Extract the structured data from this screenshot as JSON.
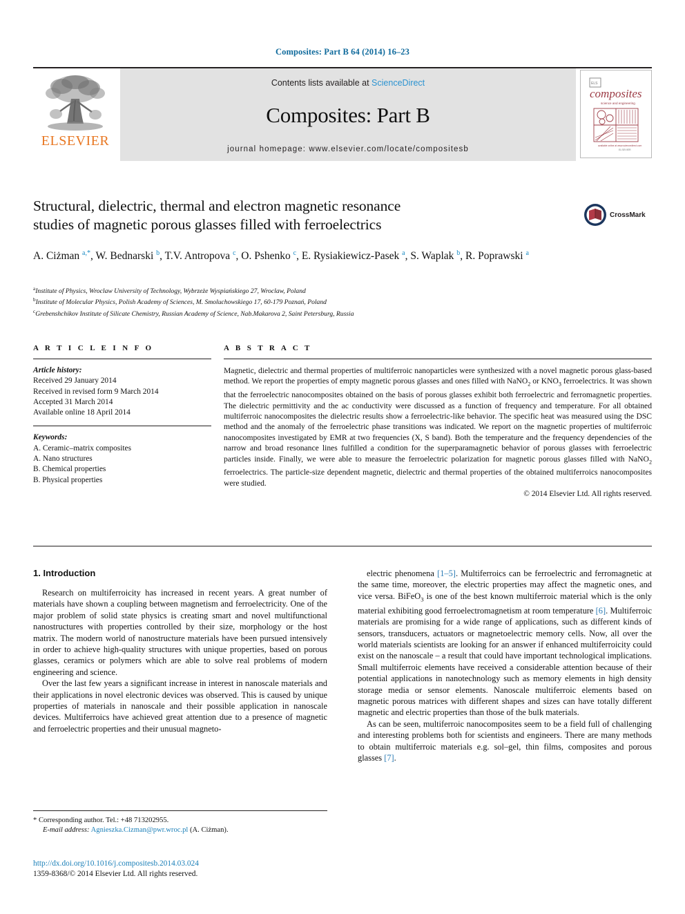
{
  "running_head": "Composites: Part B 64 (2014) 16–23",
  "journal_header": {
    "contents_prefix": "Contents lists available at",
    "sciencedirect_link": "ScienceDirect",
    "journal_title": "Composites: Part B",
    "homepage_line": "journal homepage: www.elsevier.com/locate/compositesb",
    "publisher_name": "ELSEVIER",
    "cover_title": "composites",
    "cover_subtitle": "science and engineering"
  },
  "article": {
    "title_line1": "Structural, dielectric, thermal and electron magnetic resonance",
    "title_line2": "studies of magnetic porous glasses filled with ferroelectrics",
    "crossmark_label": "CrossMark",
    "authors_html": "A. Ciżman <sup>a,*</sup>, W. Bednarski <sup>b</sup>, T.V. Antropova <sup>c</sup>, O. Pshenko <sup>c</sup>, E. Rysiakiewicz-Pasek <sup>a</sup>, S. Waplak <sup>b</sup>, R. Poprawski <sup>a</sup>",
    "affiliations": [
      {
        "mark": "a",
        "text": "Institute of Physics, Wroclaw University of Technology, Wybrzeże Wyspiańskiego 27, Wroclaw, Poland"
      },
      {
        "mark": "b",
        "text": "Institute of Molecular Physics, Polish Academy of Sciences, M. Smoluchowskiego 17, 60-179 Poznań, Poland"
      },
      {
        "mark": "c",
        "text": "Grebenshchikov Institute of Silicate Chemistry, Russian Academy of Science, Nab.Makarova 2, Saint Petersburg, Russia"
      }
    ]
  },
  "article_info": {
    "heading": "A R T I C L E   I N F O",
    "history_label": "Article history:",
    "history": [
      "Received 29 January 2014",
      "Received in revised form 9 March 2014",
      "Accepted 31 March 2014",
      "Available online 18 April 2014"
    ],
    "keywords_label": "Keywords:",
    "keywords": [
      "A. Ceramic–matrix composites",
      "A. Nano structures",
      "B. Chemical properties",
      "B. Physical properties"
    ]
  },
  "abstract": {
    "heading": "A B S T R A C T",
    "text_html": "Magnetic, dielectric and thermal properties of multiferroic nanoparticles were synthesized with a novel magnetic porous glass-based method. We report the properties of empty magnetic porous glasses and ones filled with NaNO<sub>2</sub> or KNO<sub>3</sub> ferroelectrics. It was shown that the ferroelectric nanocomposites obtained on the basis of porous glasses exhibit both ferroelectric and ferromagnetic properties. The dielectric permittivity and the ac conductivity were discussed as a function of frequency and temperature. For all obtained multiferroic nanocomposites the dielectric results show a ferroelectric-like behavior. The specific heat was measured using the DSC method and the anomaly of the ferroelectric phase transitions was indicated. We report on the magnetic properties of multiferroic nanocomposites investigated by EMR at two frequencies (X, S band). Both the temperature and the frequency dependencies of the narrow and broad resonance lines fulfilled a condition for the superparamagnetic behavior of porous glasses with ferroelectric particles inside. Finally, we were able to measure the ferroelectric polarization for magnetic porous glasses filled with NaNO<sub>2</sub> ferroelectrics. The particle-size dependent magnetic, dielectric and thermal properties of the obtained multiferroics nanocomposites were studied.",
    "copyright": "© 2014 Elsevier Ltd. All rights reserved."
  },
  "body": {
    "section_title": "1. Introduction",
    "left_paragraphs_html": [
      "Research on multiferroicity has increased in recent years. A great number of materials have shown a coupling between magnetism and ferroelectricity. One of the major problem of solid state physics is creating smart and novel multifunctional nanostructures with properties controlled by their size, morphology or the host matrix. The modern world of nanostructure materials have been pursued intensively in order to achieve high-quality structures with unique properties, based on porous glasses, ceramics or polymers which are able to solve real problems of modern engineering and science.",
      "Over the last few years a significant increase in interest in nanoscale materials and their applications in novel electronic devices was observed. This is caused by unique properties of materials in nanoscale and their possible application in nanoscale devices. Multiferroics have achieved great attention due to a presence of magnetic and ferroelectric properties and their unusual magneto-"
    ],
    "right_paragraphs_html": [
      "electric phenomena <span class=\"cite\">[1–5]</span>. Multiferroics can be ferroelectric and ferromagnetic at the same time, moreover, the electric properties may affect the magnetic ones, and vice versa. BiFeO<sub>3</sub> is one of the best known multiferroic material which is the only material exhibiting good ferroelectromagnetism at room temperature <span class=\"cite\">[6]</span>. Multiferroic materials are promising for a wide range of applications, such as different kinds of sensors, transducers, actuators or magnetoelectric memory cells. Now, all over the world materials scientists are looking for an answer if enhanced multiferroicity could exist on the nanoscale – a result that could have important technological implications. Small multiferroic elements have received a considerable attention because of their potential applications in nanotechnology such as memory elements in high density storage media or sensor elements. Nanoscale multiferroic elements based on magnetic porous matrices with different shapes and sizes can have totally different magnetic and electric properties than those of the bulk materials.",
      "As can be seen, multiferroic nanocomposites seem to be a field full of challenging and interesting problems both for scientists and engineers. There are many methods to obtain multiferroic materials e.g. sol–gel, thin films, composites and porous glasses <span class=\"cite\">[7]</span>."
    ]
  },
  "footer": {
    "corresponding_marker": "*",
    "corresponding_text": "Corresponding author. Tel.: +48 713202955.",
    "email_label": "E-mail address:",
    "email": "Agnieszka.Cizman@pwr.wroc.pl",
    "email_suffix": "(A. Ciżman).",
    "doi_url": "http://dx.doi.org/10.1016/j.compositesb.2014.03.024",
    "issn_line": "1359-8368/© 2014 Elsevier Ltd. All rights reserved."
  },
  "colors": {
    "link_blue": "#1a7fb8",
    "sciencedirect_blue": "#2b93d1",
    "elsevier_orange": "#e87722",
    "cover_maroon": "#9c3b45",
    "crossmark_blue": "#1b365d"
  }
}
